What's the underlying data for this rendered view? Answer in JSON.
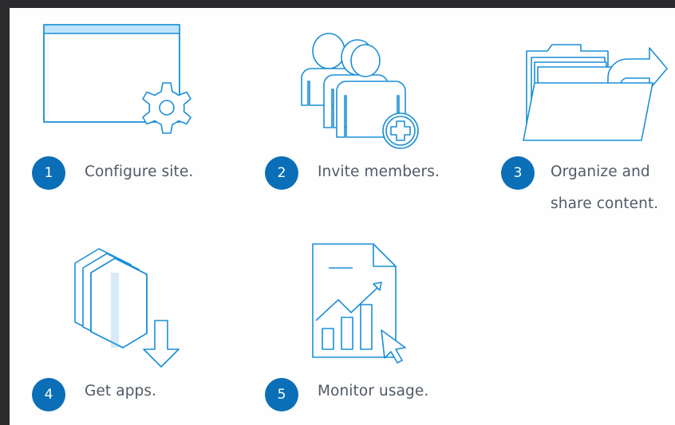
{
  "colors": {
    "accent": "#0b6fb8",
    "icon_stroke": "#1a8fd6",
    "label_text": "#505a66",
    "frame": "#2b2b2d",
    "panel": "#fefefe"
  },
  "steps": [
    {
      "number": "1",
      "label": "Configure site.",
      "icon": "site-settings-icon"
    },
    {
      "number": "2",
      "label": "Invite members.",
      "icon": "add-members-icon"
    },
    {
      "number": "3",
      "label_lines": [
        "Organize and",
        "share content."
      ],
      "icon": "share-folder-icon"
    },
    {
      "number": "4",
      "label": "Get apps.",
      "icon": "download-apps-icon"
    },
    {
      "number": "5",
      "label": "Monitor usage.",
      "icon": "usage-report-icon"
    }
  ]
}
